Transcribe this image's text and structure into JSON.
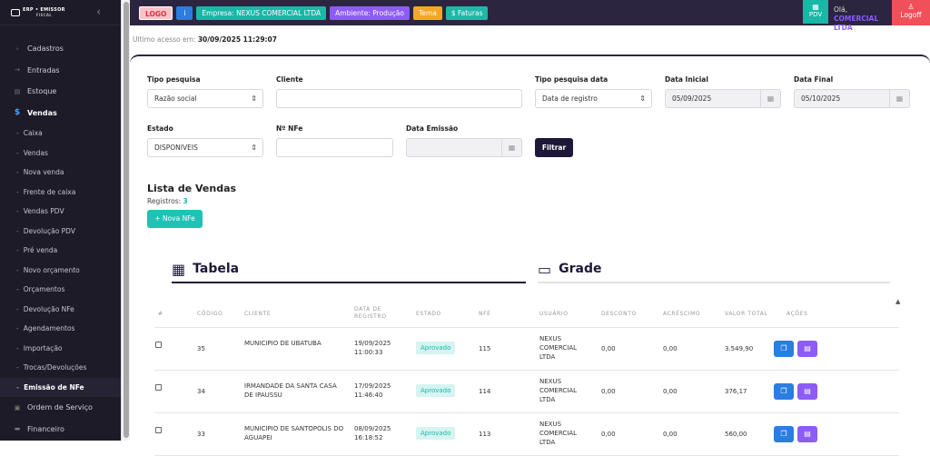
{
  "sidebar": {
    "logo_line1": "ERP • EMISSOR",
    "logo_line2": "FISCAL",
    "items_top": [
      {
        "label": "Cadastros",
        "icon": "chevron-icon"
      },
      {
        "label": "Entradas",
        "icon": "arrow-icon"
      },
      {
        "label": "Estoque",
        "icon": "box-icon"
      },
      {
        "label": "Vendas",
        "icon": "dollar-icon"
      }
    ],
    "sub_items": [
      "Caixa",
      "Vendas",
      "Nova venda",
      "Frente de caixa",
      "Vendas PDV",
      "Devolução PDV",
      "Pré venda",
      "Novo orçamento",
      "Orçamentos",
      "Devolução NFe",
      "Agendamentos",
      "Importação",
      "Trocas/Devoluções",
      "Emissão de NFe"
    ],
    "items_bottom": [
      {
        "label": "Ordem de Serviço",
        "icon": "wrench-icon"
      },
      {
        "label": "Financeiro",
        "icon": "wallet-icon"
      }
    ]
  },
  "topbar": {
    "logo": "LOGO",
    "info": "i",
    "empresa": "Empresa: NEXUS COMERCIAL LTDA",
    "ambiente": "Ambiente: Produção",
    "tema": "Tema",
    "faturas": "$ Faturas",
    "pdv": "PDV",
    "hello_prefix": "Olá,",
    "hello_name": "COMERCIAL LTDA",
    "logoff": "Logoff"
  },
  "last_access": {
    "label": "Ultimo acesso em:",
    "value": "30/09/2025 11:29:07"
  },
  "filters": {
    "tipo_pesquisa": {
      "label": "Tipo pesquisa",
      "value": "Razão social"
    },
    "cliente": {
      "label": "Cliente",
      "value": ""
    },
    "tipo_pesquisa_data": {
      "label": "Tipo pesquisa data",
      "value": "Data de registro"
    },
    "data_inicial": {
      "label": "Data Inicial",
      "value": "05/09/2025"
    },
    "data_final": {
      "label": "Data Final",
      "value": "05/10/2025"
    },
    "estado": {
      "label": "Estado",
      "value": "DISPONIVEIS"
    },
    "nfe": {
      "label": "Nº NFe",
      "value": ""
    },
    "data_emissao": {
      "label": "Data Emissão",
      "value": ""
    },
    "filtrar": "Filtrar"
  },
  "lista": {
    "title": "Lista de Vendas",
    "registros_label": "Registros:",
    "registros_count": "3",
    "nova_nfe": "+ Nova NFe"
  },
  "tabs": {
    "tabela": "Tabela",
    "grade": "Grade"
  },
  "table": {
    "headers": [
      "#",
      "Código",
      "Cliente",
      "Data de registro",
      "Estado",
      "NFe",
      "Usuário",
      "Desconto",
      "Acréscimo",
      "Valor total",
      "Ações"
    ],
    "rows": [
      {
        "codigo": "35",
        "cliente": "MUNICIPIO DE UBATUBA",
        "data": "19/09/2025",
        "hora": "11:00:33",
        "estado": "Aprovado",
        "nfe": "115",
        "usuario": "NEXUS COMERCIAL LTDA",
        "desconto": "0,00",
        "acrescimo": "0,00",
        "valor": "3.549,90"
      },
      {
        "codigo": "34",
        "cliente": "IRMANDADE DA SANTA CASA DE IPAUSSU",
        "data": "17/09/2025",
        "hora": "11:46:40",
        "estado": "Aprovado",
        "nfe": "114",
        "usuario": "NEXUS COMERCIAL LTDA",
        "desconto": "0,00",
        "acrescimo": "0,00",
        "valor": "376,17"
      },
      {
        "codigo": "33",
        "cliente": "MUNICIPIO DE SANTOPOLIS DO AGUAPEI",
        "data": "08/09/2025",
        "hora": "16:18:52",
        "estado": "Aprovado",
        "nfe": "113",
        "usuario": "NEXUS COMERCIAL LTDA",
        "desconto": "0,00",
        "acrescimo": "0,00",
        "valor": "560,00"
      }
    ]
  },
  "colors": {
    "topbar": "#2b2540",
    "sidebar": "#1d1b27",
    "accent_teal": "#17b8a6",
    "accent_purple": "#8d5cf6",
    "accent_blue": "#2a7de1",
    "logoff_red": "#f0505a"
  }
}
